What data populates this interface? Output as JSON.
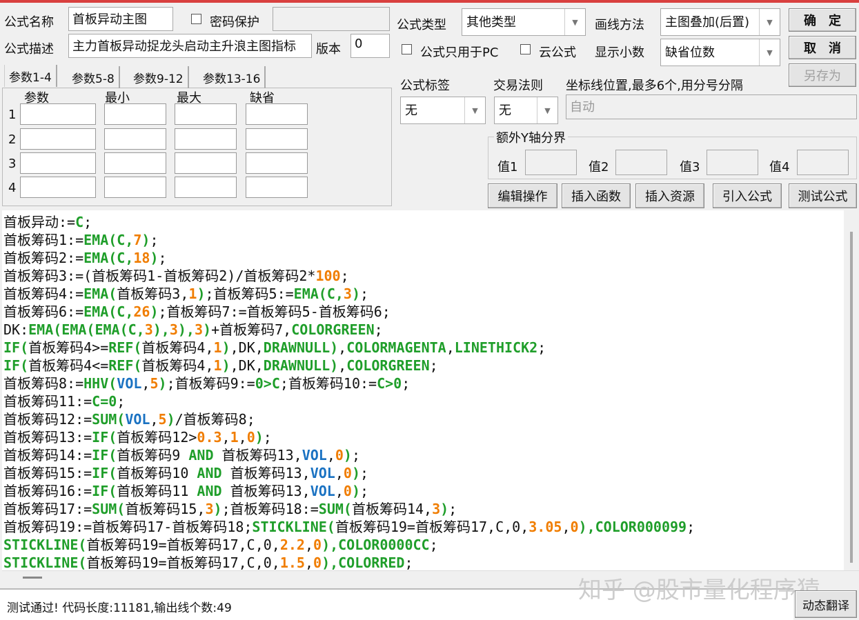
{
  "form": {
    "name_label": "公式名称",
    "name_value": "首板异动主图",
    "password_label": "密码保护",
    "desc_label": "公式描述",
    "desc_value": "主力首板异动捉龙头启动主升浪主图指标",
    "version_label": "版本",
    "version_value": "0",
    "type_label": "公式类型",
    "type_value": "其他类型",
    "draw_label": "画线方法",
    "draw_value": "主图叠加(后置)",
    "pc_only_label": "公式只用于PC",
    "cloud_label": "云公式",
    "decimals_label": "显示小数",
    "decimals_value": "缺省位数",
    "tag_label": "公式标签",
    "tag_value": "无",
    "trade_label": "交易法则",
    "trade_value": "无",
    "axis_label": "坐标线位置,最多6个,用分号分隔",
    "axis_placeholder": "自动",
    "yaxis_group": "额外Y轴分界",
    "y_values": [
      "值1",
      "值2",
      "值3",
      "值4"
    ]
  },
  "buttons": {
    "ok": "确　定",
    "cancel": "取　消",
    "save_as": "另存为",
    "edit": "编辑操作",
    "insert_func": "插入函数",
    "insert_res": "插入资源",
    "import": "引入公式",
    "test": "测试公式",
    "translate": "动态翻译"
  },
  "params": {
    "tabs": [
      "参数1-4",
      "参数5-8",
      "参数9-12",
      "参数13-16"
    ],
    "headers": [
      "参数",
      "最小",
      "最大",
      "缺省"
    ],
    "rows": [
      "1",
      "2",
      "3",
      "4"
    ]
  },
  "code_lines": [
    [
      [
        "t",
        "首板异动:="
      ],
      [
        "f",
        "C"
      ],
      [
        "t",
        ";"
      ]
    ],
    [
      [
        "t",
        "首板筹码1:="
      ],
      [
        "f",
        "EMA(C,"
      ],
      [
        "n",
        "7"
      ],
      [
        "f",
        ")"
      ],
      [
        "t",
        ";"
      ]
    ],
    [
      [
        "t",
        "首板筹码2:="
      ],
      [
        "f",
        "EMA(C,"
      ],
      [
        "n",
        "18"
      ],
      [
        "f",
        ")"
      ],
      [
        "t",
        ";"
      ]
    ],
    [
      [
        "t",
        "首板筹码3:=(首板筹码1-首板筹码2)/首板筹码2*"
      ],
      [
        "n",
        "100"
      ],
      [
        "t",
        ";"
      ]
    ],
    [
      [
        "t",
        "首板筹码4:="
      ],
      [
        "f",
        "EMA("
      ],
      [
        "t",
        "首板筹码3,"
      ],
      [
        "n",
        "1"
      ],
      [
        "f",
        ")"
      ],
      [
        "t",
        ";首板筹码5:="
      ],
      [
        "f",
        "EMA(C,"
      ],
      [
        "n",
        "3"
      ],
      [
        "f",
        ")"
      ],
      [
        "t",
        ";"
      ]
    ],
    [
      [
        "t",
        "首板筹码6:="
      ],
      [
        "f",
        "EMA(C,"
      ],
      [
        "n",
        "26"
      ],
      [
        "f",
        ")"
      ],
      [
        "t",
        ";首板筹码7:=首板筹码5-首板筹码6;"
      ]
    ],
    [
      [
        "t",
        "DK:"
      ],
      [
        "f",
        "EMA(EMA(EMA(C,"
      ],
      [
        "n",
        "3"
      ],
      [
        "f",
        "),"
      ],
      [
        "n",
        "3"
      ],
      [
        "f",
        "),"
      ],
      [
        "n",
        "3"
      ],
      [
        "f",
        ")"
      ],
      [
        "t",
        "+首板筹码7,"
      ],
      [
        "f",
        "COLORGREEN"
      ],
      [
        "t",
        ";"
      ]
    ],
    [
      [
        "f",
        "IF("
      ],
      [
        "t",
        "首板筹码4>="
      ],
      [
        "f",
        "REF("
      ],
      [
        "t",
        "首板筹码4,"
      ],
      [
        "n",
        "1"
      ],
      [
        "f",
        ")"
      ],
      [
        "t",
        ",DK,"
      ],
      [
        "f",
        "DRAWNULL)"
      ],
      [
        "t",
        ","
      ],
      [
        "f",
        "COLORMAGENTA"
      ],
      [
        "t",
        ","
      ],
      [
        "f",
        "LINETHICK2"
      ],
      [
        "t",
        ";"
      ]
    ],
    [
      [
        "f",
        "IF("
      ],
      [
        "t",
        "首板筹码4<="
      ],
      [
        "f",
        "REF("
      ],
      [
        "t",
        "首板筹码4,"
      ],
      [
        "n",
        "1"
      ],
      [
        "f",
        ")"
      ],
      [
        "t",
        ",DK,"
      ],
      [
        "f",
        "DRAWNULL)"
      ],
      [
        "t",
        ","
      ],
      [
        "f",
        "COLORGREEN"
      ],
      [
        "t",
        ";"
      ]
    ],
    [
      [
        "t",
        "首板筹码8:="
      ],
      [
        "f",
        "HHV("
      ],
      [
        "v",
        "VOL"
      ],
      [
        "t",
        ","
      ],
      [
        "n",
        "5"
      ],
      [
        "f",
        ")"
      ],
      [
        "t",
        ";首板筹码9:="
      ],
      [
        "f",
        "0>C"
      ],
      [
        "t",
        ";首板筹码10:="
      ],
      [
        "f",
        "C>0"
      ],
      [
        "t",
        ";"
      ]
    ],
    [
      [
        "t",
        "首板筹码11:="
      ],
      [
        "f",
        "C=0"
      ],
      [
        "t",
        ";"
      ]
    ],
    [
      [
        "t",
        "首板筹码12:="
      ],
      [
        "f",
        "SUM("
      ],
      [
        "v",
        "VOL"
      ],
      [
        "t",
        ","
      ],
      [
        "n",
        "5"
      ],
      [
        "f",
        ")"
      ],
      [
        "t",
        "/首板筹码8;"
      ]
    ],
    [
      [
        "t",
        "首板筹码13:="
      ],
      [
        "f",
        "IF("
      ],
      [
        "t",
        "首板筹码12>"
      ],
      [
        "n",
        "0.3"
      ],
      [
        "t",
        ","
      ],
      [
        "n",
        "1"
      ],
      [
        "t",
        ","
      ],
      [
        "n",
        "0"
      ],
      [
        "f",
        ")"
      ],
      [
        "t",
        ";"
      ]
    ],
    [
      [
        "t",
        "首板筹码14:="
      ],
      [
        "f",
        "IF("
      ],
      [
        "t",
        "首板筹码9 "
      ],
      [
        "f",
        "AND"
      ],
      [
        "t",
        " 首板筹码13,"
      ],
      [
        "v",
        "VOL"
      ],
      [
        "t",
        ","
      ],
      [
        "n",
        "0"
      ],
      [
        "f",
        ")"
      ],
      [
        "t",
        ";"
      ]
    ],
    [
      [
        "t",
        "首板筹码15:="
      ],
      [
        "f",
        "IF("
      ],
      [
        "t",
        "首板筹码10 "
      ],
      [
        "f",
        "AND"
      ],
      [
        "t",
        " 首板筹码13,"
      ],
      [
        "v",
        "VOL"
      ],
      [
        "t",
        ","
      ],
      [
        "n",
        "0"
      ],
      [
        "f",
        ")"
      ],
      [
        "t",
        ";"
      ]
    ],
    [
      [
        "t",
        "首板筹码16:="
      ],
      [
        "f",
        "IF("
      ],
      [
        "t",
        "首板筹码11 "
      ],
      [
        "f",
        "AND"
      ],
      [
        "t",
        " 首板筹码13,"
      ],
      [
        "v",
        "VOL"
      ],
      [
        "t",
        ","
      ],
      [
        "n",
        "0"
      ],
      [
        "f",
        ")"
      ],
      [
        "t",
        ";"
      ]
    ],
    [
      [
        "t",
        "首板筹码17:="
      ],
      [
        "f",
        "SUM("
      ],
      [
        "t",
        "首板筹码15,"
      ],
      [
        "n",
        "3"
      ],
      [
        "f",
        ")"
      ],
      [
        "t",
        ";首板筹码18:="
      ],
      [
        "f",
        "SUM("
      ],
      [
        "t",
        "首板筹码14,"
      ],
      [
        "n",
        "3"
      ],
      [
        "f",
        ")"
      ],
      [
        "t",
        ";"
      ]
    ],
    [
      [
        "t",
        "首板筹码19:=首板筹码17-首板筹码18;"
      ],
      [
        "f",
        "STICKLINE("
      ],
      [
        "t",
        "首板筹码19=首板筹码17,C,0,"
      ],
      [
        "n",
        "3.05"
      ],
      [
        "t",
        ","
      ],
      [
        "n",
        "0"
      ],
      [
        "f",
        "),COLOR000099"
      ],
      [
        "t",
        ";"
      ]
    ],
    [
      [
        "f",
        "STICKLINE("
      ],
      [
        "t",
        "首板筹码19=首板筹码17,C,0,"
      ],
      [
        "n",
        "2.2"
      ],
      [
        "t",
        ","
      ],
      [
        "n",
        "0"
      ],
      [
        "f",
        "),COLOR0000CC"
      ],
      [
        "t",
        ";"
      ]
    ],
    [
      [
        "f",
        "STICKLINE("
      ],
      [
        "t",
        "首板筹码19=首板筹码17,C,0,"
      ],
      [
        "n",
        "1.5"
      ],
      [
        "t",
        ","
      ],
      [
        "n",
        "0"
      ],
      [
        "f",
        "),COLORRED"
      ],
      [
        "t",
        ";"
      ]
    ]
  ],
  "status": "测试通过! 代码长度:11181,输出线个数:49",
  "watermark": "知乎 @股市量化程序猿",
  "colors": {
    "accent": "#d9403f",
    "function": "#1f9e2a",
    "number": "#f07d00",
    "variable": "#1a72c2"
  }
}
